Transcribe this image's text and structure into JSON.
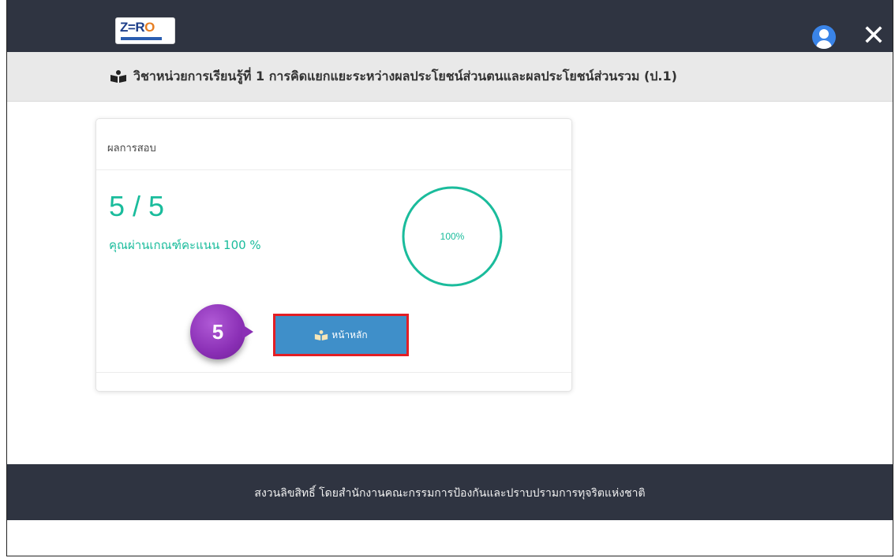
{
  "header": {
    "logo_text": "ZERO",
    "user_icon": "user-icon",
    "close_icon": "close-icon",
    "close_glyph": "✕"
  },
  "subject": {
    "icon": "book-reader-icon",
    "title": "วิชาหน่วยการเรียนรู้ที่ 1 การคิดแยกแยะระหว่างผลประโยชน์ส่วนตนและผลประโยชน์ส่วนรวม (ป.1)"
  },
  "result": {
    "header": "ผลการสอบ",
    "score": "5 / 5",
    "pass_text": "คุณผ่านเกณฑ์คะแนน 100 %",
    "progress_label": "100%",
    "progress_fraction": 1.0,
    "home_button_label": "หน้าหลัก",
    "home_button_icon": "book-reader-icon"
  },
  "step_badge": {
    "number": "5"
  },
  "footer": {
    "text": "สงวนลิขสิทธิ์ โดยสำนักงานคณะกรรมการป้องกันและปราบปรามการทุจริตแห่งชาติ"
  },
  "colors": {
    "nav_bg": "#2f3441",
    "accent_green": "#1abc9c",
    "button_blue": "#3f8fc9",
    "highlight_red": "#e31e24",
    "badge_purple": "#8a2fb5"
  }
}
